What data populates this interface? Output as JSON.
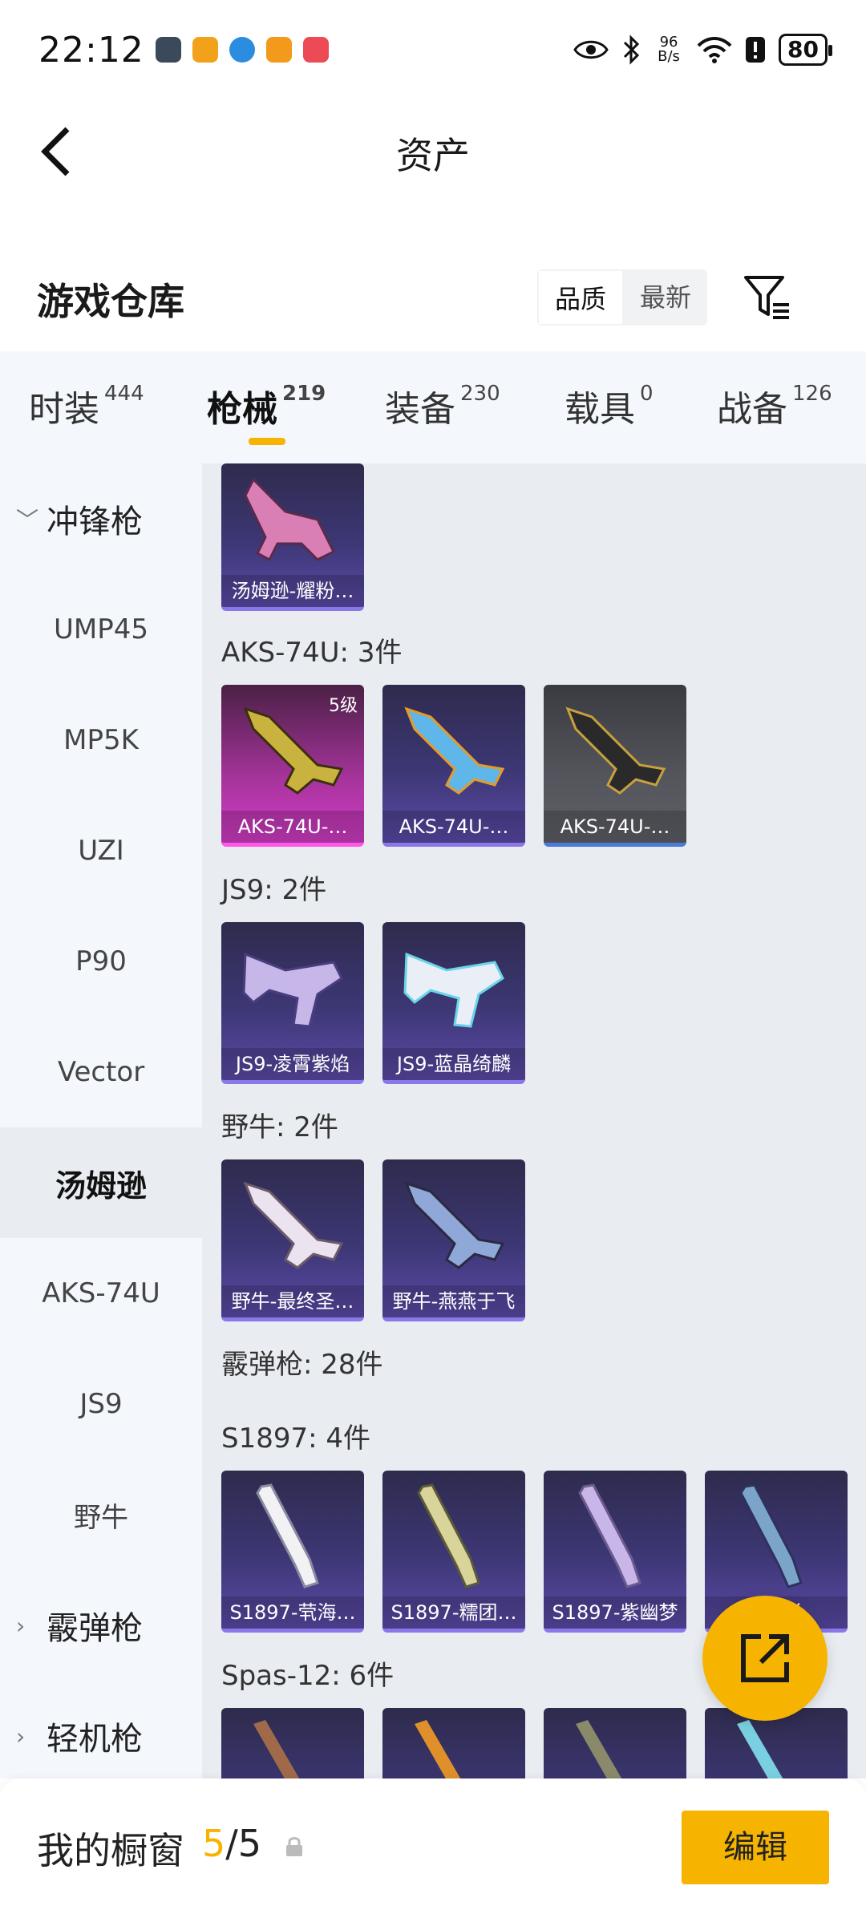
{
  "status_bar": {
    "time": "22:12",
    "net_speed_value": "96",
    "net_speed_unit": "B/s",
    "battery": "80",
    "app_icon_colors": [
      "#3b4a5a",
      "#f2a11b",
      "#2a8de0",
      "#f39a1c",
      "#ec4b55"
    ]
  },
  "header": {
    "title": "资产"
  },
  "warehouse": {
    "title": "游戏仓库",
    "sort_options": [
      "品质",
      "最新"
    ],
    "active_sort": "品质"
  },
  "tabs": [
    {
      "label": "时装",
      "count": "444"
    },
    {
      "label": "枪械",
      "count": "219",
      "active": true
    },
    {
      "label": "装备",
      "count": "230"
    },
    {
      "label": "载具",
      "count": "0"
    },
    {
      "label": "战备",
      "count": "126"
    }
  ],
  "sidebar": {
    "items": [
      {
        "label": "冲锋枪",
        "type": "group",
        "expanded": true
      },
      {
        "label": "UMP45"
      },
      {
        "label": "MP5K"
      },
      {
        "label": "UZI"
      },
      {
        "label": "P90"
      },
      {
        "label": "Vector"
      },
      {
        "label": "汤姆逊",
        "selected": true
      },
      {
        "label": "AKS-74U"
      },
      {
        "label": "JS9"
      },
      {
        "label": "野牛"
      },
      {
        "label": "霰弹枪",
        "type": "group"
      },
      {
        "label": "轻机枪",
        "type": "group"
      }
    ]
  },
  "content": {
    "top_card": {
      "label": "汤姆逊-耀粉…",
      "style": "purple"
    },
    "sections": [
      {
        "title": "AKS-74U: 3件",
        "items": [
          {
            "label": "AKS-74U-…",
            "style": "pink",
            "badge": "5级"
          },
          {
            "label": "AKS-74U-…",
            "style": "purple"
          },
          {
            "label": "AKS-74U-…",
            "style": "gray"
          }
        ]
      },
      {
        "title": "JS9: 2件",
        "items": [
          {
            "label": "JS9-凌霄紫焰",
            "style": "purple"
          },
          {
            "label": "JS9-蓝晶绮麟",
            "style": "purple"
          }
        ]
      },
      {
        "title": "野牛: 2件",
        "items": [
          {
            "label": "野牛-最终圣…",
            "style": "purple"
          },
          {
            "label": "野牛-燕燕于飞",
            "style": "purple"
          }
        ]
      },
      {
        "title": "霰弹枪: 28件",
        "items": []
      },
      {
        "title": "S1897: 4件",
        "items": [
          {
            "label": "S1897-茕海…",
            "style": "purple"
          },
          {
            "label": "S1897-糯团…",
            "style": "purple"
          },
          {
            "label": "S1897-紫幽梦",
            "style": "purple"
          },
          {
            "label": "S…彩",
            "style": "purple"
          }
        ]
      },
      {
        "title": "Spas-12: 6件",
        "items": []
      }
    ]
  },
  "bottom_bar": {
    "label": "我的橱窗",
    "current": "5",
    "separator": "/",
    "total": "5",
    "edit_label": "编辑"
  },
  "colors": {
    "accent": "#f6b400",
    "tab_bg": "#f4f8fd",
    "content_bg": "#e9ecf1"
  }
}
